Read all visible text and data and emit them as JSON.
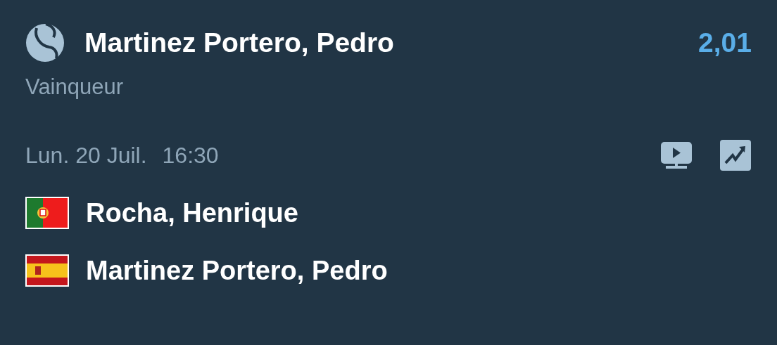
{
  "selection": {
    "name": "Martinez Portero, Pedro",
    "odds": "2,01",
    "market": "Vainqueur"
  },
  "event": {
    "date": "Lun. 20 Juil.",
    "time": "16:30"
  },
  "players": [
    {
      "name": "Rocha, Henrique",
      "kind": "pt"
    },
    {
      "name": "Martinez Portero, Pedro",
      "kind": "es"
    }
  ]
}
